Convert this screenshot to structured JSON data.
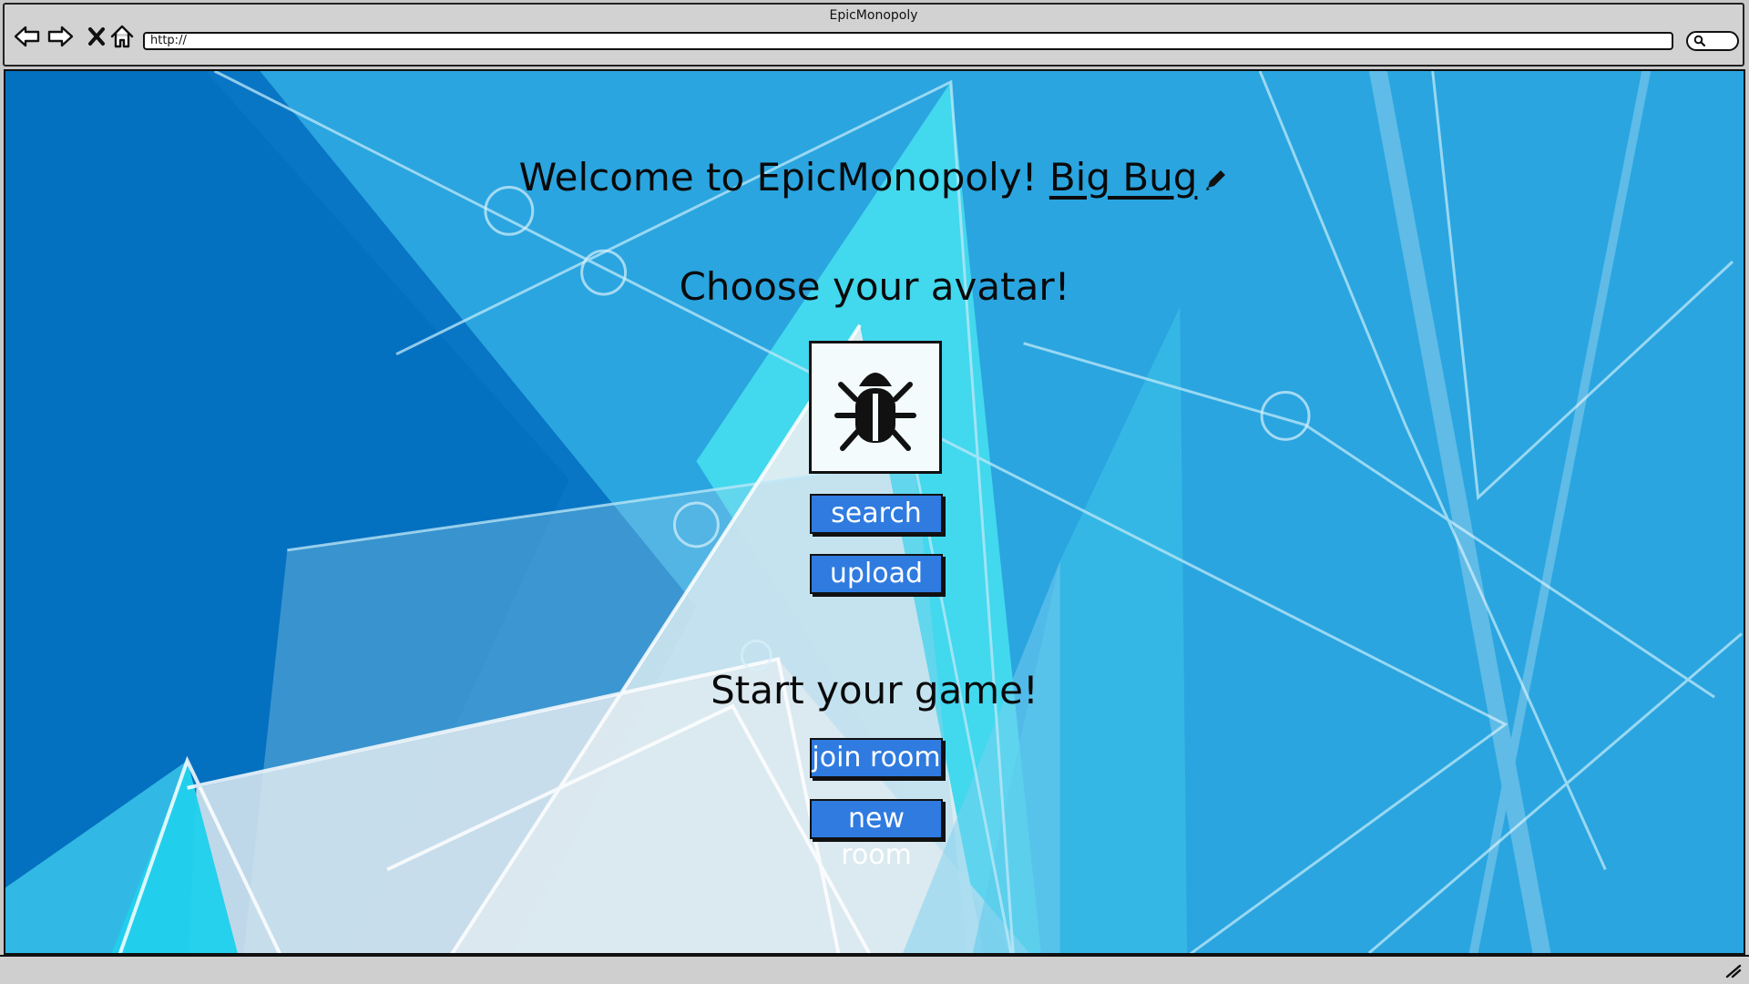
{
  "window": {
    "title": "EpicMonopoly"
  },
  "browser": {
    "url": "http://",
    "icons": [
      "back-arrow-icon",
      "forward-arrow-icon",
      "close-icon",
      "home-icon",
      "search-icon",
      "resize-grip-icon"
    ]
  },
  "page": {
    "welcome_prefix": "Welcome to EpicMonopoly!",
    "username": "Big Bug",
    "avatar_heading": "Choose your avatar!",
    "avatar_icon": "bug-icon",
    "search_label": "search",
    "upload_label": "upload",
    "game_heading": "Start your game!",
    "join_room_label": "join room",
    "new_room_label": "new room"
  },
  "colors": {
    "background": "#2aa5e0",
    "button": "#2f7be0",
    "button_text": "#ffffff",
    "text": "#0a0a0a"
  }
}
